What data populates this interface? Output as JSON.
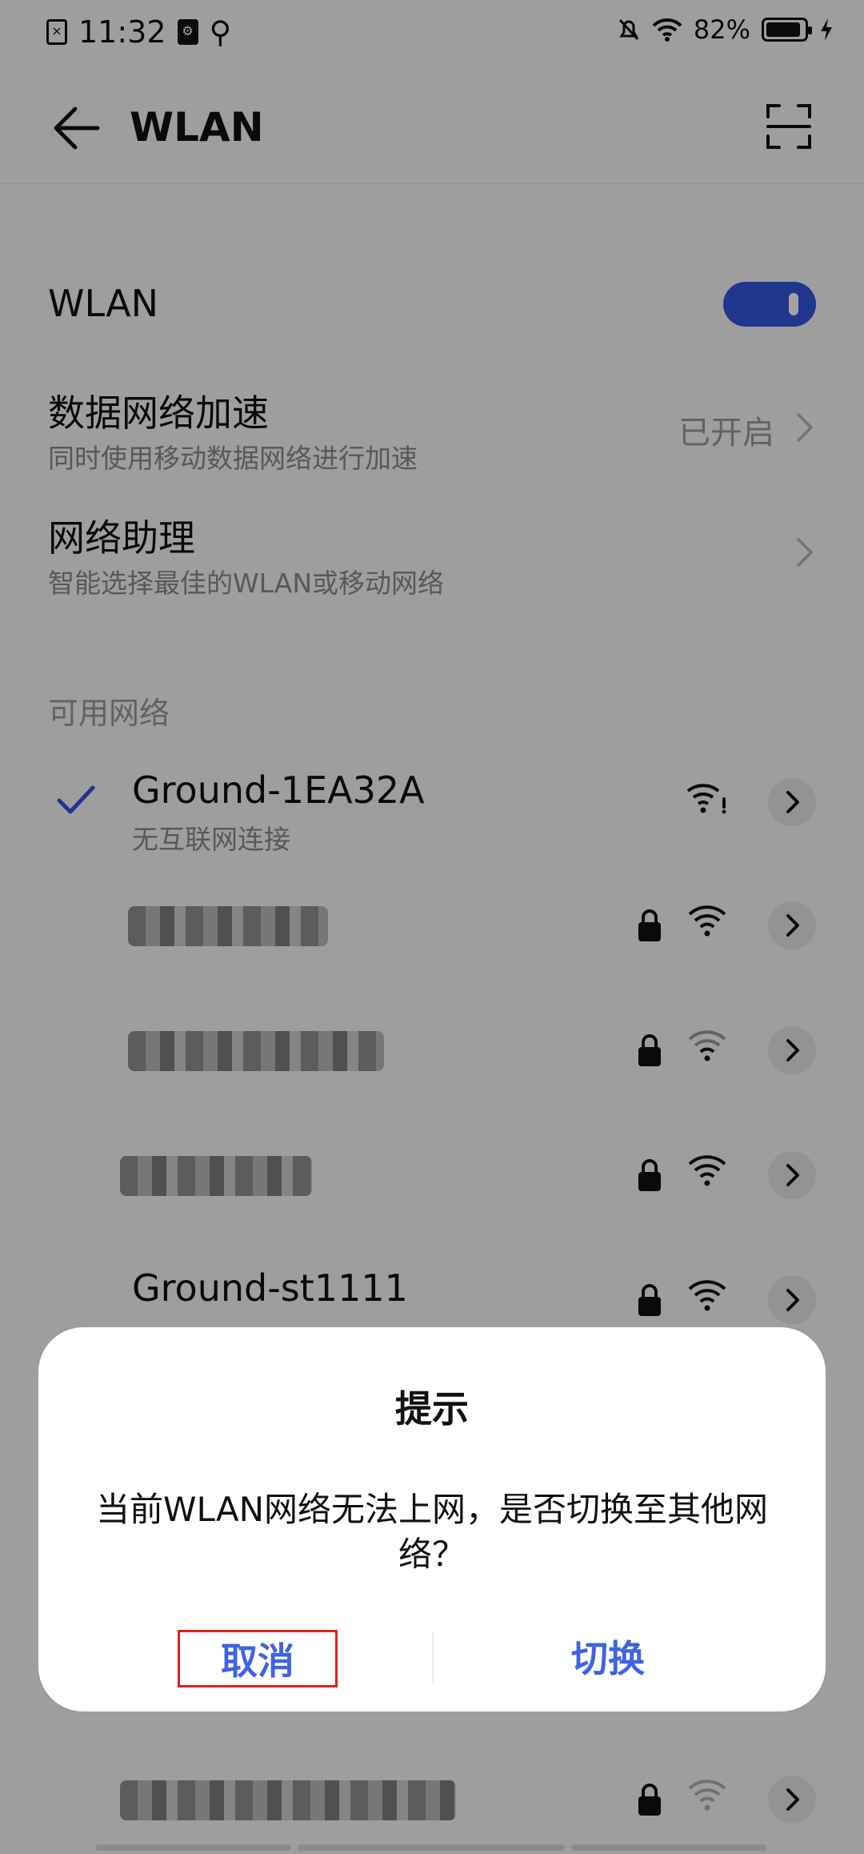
{
  "status_bar": {
    "time": "11:32",
    "battery_percent": "82%",
    "icons": [
      "sim-error-icon",
      "usb-debug-icon",
      "usb-icon",
      "mute-bell-icon",
      "wifi-icon",
      "battery-icon",
      "charging-icon"
    ]
  },
  "header": {
    "title": "WLAN",
    "back_icon": "back-arrow-icon",
    "scan_icon": "scan-icon"
  },
  "wlan_toggle": {
    "label": "WLAN",
    "on": true
  },
  "settings": [
    {
      "title": "数据网络加速",
      "subtitle": "同时使用移动数据网络进行加速",
      "value": "已开启"
    },
    {
      "title": "网络助理",
      "subtitle": "智能选择最佳的WLAN或移动网络",
      "value": ""
    }
  ],
  "networks_section": {
    "label": "可用网络",
    "items": [
      {
        "name": "Ground-1EA32A",
        "status": "无互联网连接",
        "connected": true,
        "locked": false,
        "signal": "warning"
      },
      {
        "name": "",
        "status": "",
        "connected": false,
        "locked": true,
        "signal": "full",
        "blurred": true
      },
      {
        "name": "",
        "status": "",
        "connected": false,
        "locked": true,
        "signal": "weak",
        "blurred": true
      },
      {
        "name": "",
        "status": "",
        "connected": false,
        "locked": true,
        "signal": "full",
        "blurred": true
      },
      {
        "name": "Ground-st1111",
        "status": "",
        "connected": false,
        "locked": true,
        "signal": "full"
      },
      {
        "name": "",
        "status": "",
        "connected": false,
        "locked": true,
        "signal": "weak",
        "blurred": true
      }
    ]
  },
  "dialog": {
    "title": "提示",
    "message": "当前WLAN网络无法上网，是否切换至其他网络？",
    "cancel_label": "取消",
    "switch_label": "切换"
  },
  "colors": {
    "accent": "#3f63e3",
    "toggle": "#3355e0",
    "highlight": "#e02020"
  }
}
